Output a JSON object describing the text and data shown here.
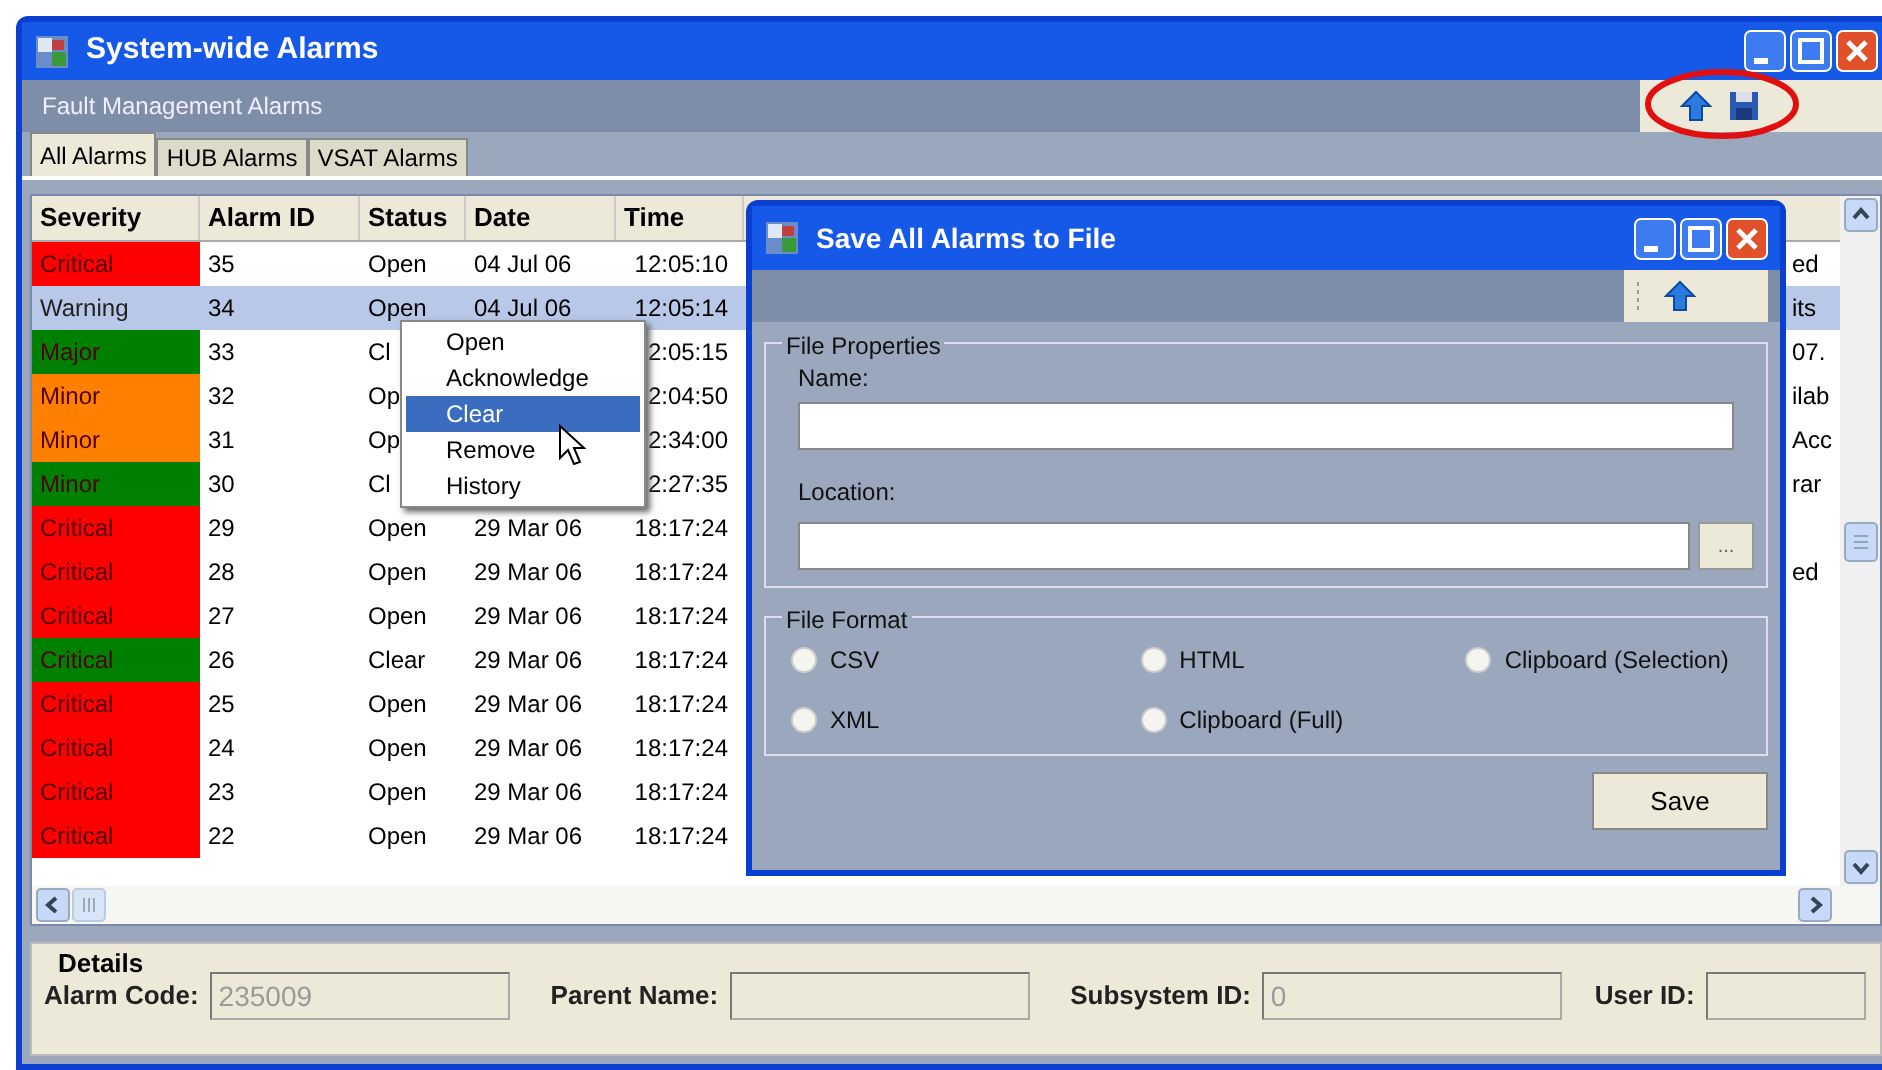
{
  "window": {
    "title": "System-wide Alarms",
    "subtitle": "Fault Management Alarms"
  },
  "tabs": [
    {
      "label": "All Alarms",
      "selected": true
    },
    {
      "label": "HUB Alarms",
      "selected": false
    },
    {
      "label": "VSAT Alarms",
      "selected": false
    }
  ],
  "table": {
    "columns": [
      "Severity",
      "Alarm ID",
      "Status",
      "Date",
      "Time"
    ],
    "rows": [
      {
        "severity": "Critical",
        "color": "#ff0000",
        "alarm_id": "35",
        "status": "Open",
        "date": "04 Jul 06",
        "time": "12:05:10",
        "column_6": "ed",
        "selected": false
      },
      {
        "severity": "Warning",
        "alarm_id": "34",
        "status": "Open",
        "date": "04 Jul 06",
        "time": "12:05:14",
        "column_6": "its",
        "selected": true
      },
      {
        "severity": "Major",
        "color": "#008000",
        "alarm_id": "33",
        "status": "Cl",
        "time": "2:05:15",
        "column_6": "07.",
        "selected": false
      },
      {
        "severity": "Minor",
        "color": "#ff8000",
        "alarm_id": "32",
        "status": "Op",
        "time": "2:04:50",
        "column_6": "ilab",
        "selected": false
      },
      {
        "severity": "Minor",
        "color": "#ff8000",
        "alarm_id": "31",
        "status": "Op",
        "time": "2:34:00",
        "column_6": "Acc",
        "selected": false
      },
      {
        "severity": "Minor",
        "color": "#008000",
        "alarm_id": "30",
        "status": "Cl",
        "time": "2:27:35",
        "column_6": "rar",
        "selected": false
      },
      {
        "severity": "Critical",
        "color": "#ff0000",
        "alarm_id": "29",
        "status": "Open",
        "date": "29 Mar 06",
        "time": "18:17:24",
        "selected": false
      },
      {
        "severity": "Critical",
        "color": "#ff0000",
        "alarm_id": "28",
        "status": "Open",
        "date": "29 Mar 06",
        "time": "18:17:24",
        "column_6": "ed",
        "selected": false
      },
      {
        "severity": "Critical",
        "color": "#ff0000",
        "alarm_id": "27",
        "status": "Open",
        "date": "29 Mar 06",
        "time": "18:17:24",
        "selected": false
      },
      {
        "severity": "Critical",
        "color": "#008000",
        "alarm_id": "26",
        "status": "Clear",
        "date": "29 Mar 06",
        "time": "18:17:24",
        "selected": false
      },
      {
        "severity": "Critical",
        "color": "#ff0000",
        "alarm_id": "25",
        "status": "Open",
        "date": "29 Mar 06",
        "time": "18:17:24",
        "selected": false
      },
      {
        "severity": "Critical",
        "color": "#ff0000",
        "alarm_id": "24",
        "status": "Open",
        "date": "29 Mar 06",
        "time": "18:17:24",
        "selected": false
      },
      {
        "severity": "Critical",
        "color": "#ff0000",
        "alarm_id": "23",
        "status": "Open",
        "date": "29 Mar 06",
        "time": "18:17:24",
        "selected": false
      },
      {
        "severity": "Critical",
        "color": "#ff0000",
        "alarm_id": "22",
        "status": "Open",
        "date": "29 Mar 06",
        "time": "18:17:24",
        "selected": false
      }
    ]
  },
  "context_menu": {
    "items": [
      {
        "label": "Open",
        "selected": false
      },
      {
        "label": "Acknowledge",
        "selected": false
      },
      {
        "label": "Clear",
        "selected": true
      },
      {
        "label": "Remove",
        "selected": false
      },
      {
        "label": "History",
        "selected": false
      }
    ]
  },
  "dialog": {
    "title": "Save All Alarms to File",
    "file_properties": {
      "title": "File Properties",
      "name_label": "Name:",
      "location_label": "Location:",
      "browse_button": "..."
    },
    "file_format": {
      "title": "File Format",
      "options": [
        {
          "label": "CSV",
          "selected": false
        },
        {
          "label": "HTML",
          "selected": false
        },
        {
          "label": "Clipboard (Selection)",
          "selected": false
        },
        {
          "label": "XML",
          "selected": false
        },
        {
          "label": "Clipboard (Full)",
          "selected": false
        }
      ]
    },
    "save_button": "Save"
  },
  "details": {
    "title": "Details",
    "fields": [
      {
        "label": "Alarm Code:",
        "value": "235009"
      },
      {
        "label": "Parent Name:"
      },
      {
        "label": "Subsystem ID:",
        "value": "0"
      },
      {
        "label": "User ID:"
      }
    ]
  }
}
